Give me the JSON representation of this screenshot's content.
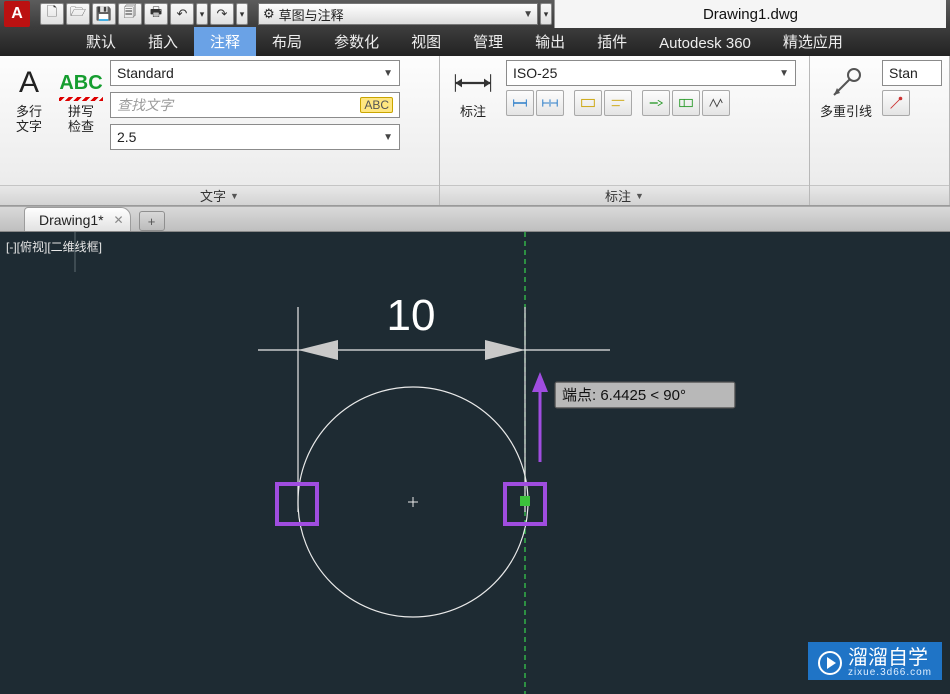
{
  "title": "Drawing1.dwg",
  "workspace": "草图与注释",
  "tabs": [
    "默认",
    "插入",
    "注释",
    "布局",
    "参数化",
    "视图",
    "管理",
    "输出",
    "插件",
    "Autodesk 360",
    "精选应用"
  ],
  "active_tab_index": 2,
  "text_panel": {
    "title": "文字",
    "mtext_label": "多行\n文字",
    "spell_label": "拼写\n检查",
    "spell_abc": "ABC",
    "style_value": "Standard",
    "search_placeholder": "查找文字",
    "height_value": "2.5"
  },
  "dim_panel": {
    "title": "标注",
    "big_label": "标注",
    "style_value": "ISO-25"
  },
  "leader_panel": {
    "big_label": "多重引线",
    "style_value": "Stan"
  },
  "file_tab": "Drawing1*",
  "view_label": "[-][俯视][二维线框]",
  "dim_value": "10",
  "tooltip": "端点: 6.4425 < 90°",
  "watermark": {
    "main": "溜溜自学",
    "sub": "zixue.3d66.com"
  }
}
